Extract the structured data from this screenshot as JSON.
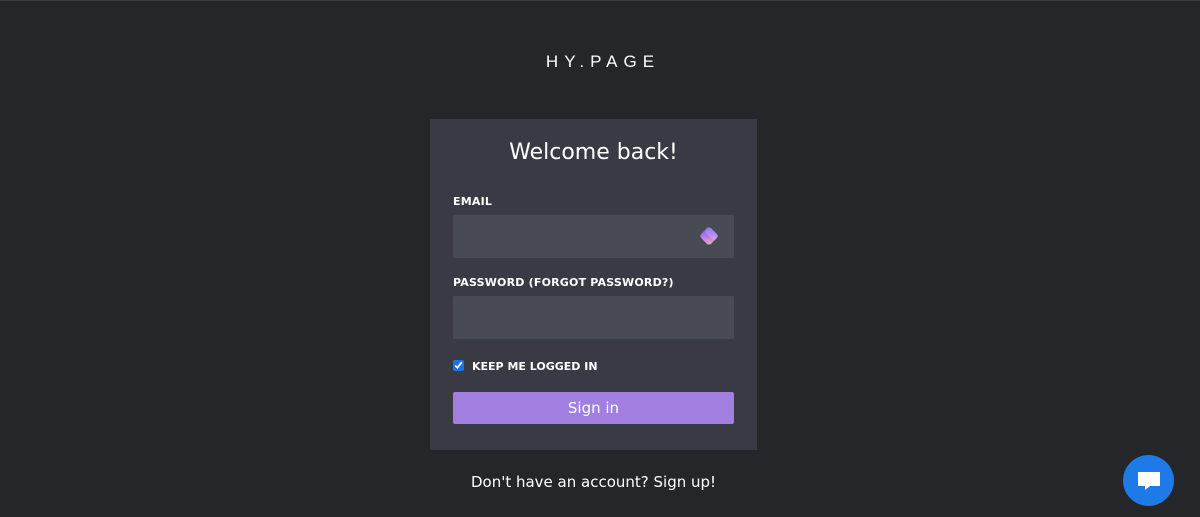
{
  "brand": {
    "logo_text": "HY.PAGE"
  },
  "login": {
    "title": "Welcome back!",
    "email": {
      "label": "EMAIL",
      "value": "",
      "placeholder": ""
    },
    "password": {
      "label": "PASSWORD (FORGOT PASSWORD?)",
      "value": "",
      "placeholder": ""
    },
    "remember": {
      "label": "KEEP ME LOGGED IN",
      "checked": true
    },
    "submit_label": "Sign in"
  },
  "footer": {
    "signup_text": "Don't have an account? Sign up!"
  },
  "chat": {
    "icon": "chat-bubble-icon",
    "color": "#1e7ae6"
  },
  "colors": {
    "background": "#252629",
    "card": "#3a3a45",
    "input": "#494b54",
    "accent": "#a07fe1"
  }
}
